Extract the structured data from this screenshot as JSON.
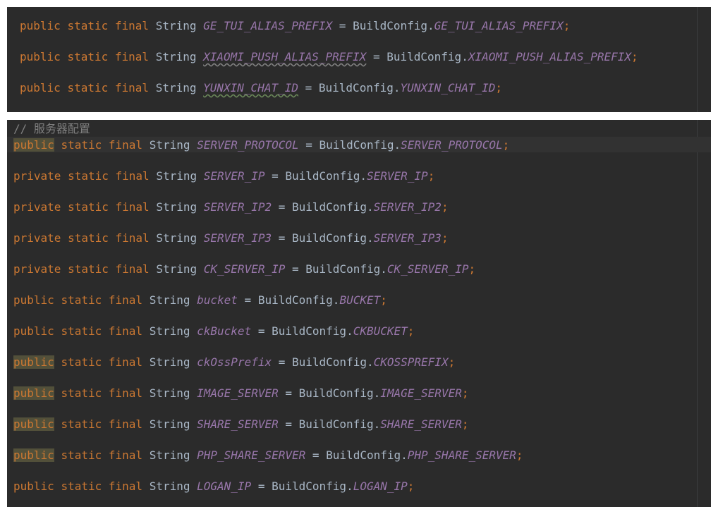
{
  "panel1": {
    "lines": [
      {
        "mod": "public",
        "static": "static",
        "final": "final",
        "type": "String",
        "name": "GE_TUI_ALIAS_PREFIX",
        "cls": "BuildConfig",
        "field": "GE_TUI_ALIAS_PREFIX"
      },
      {
        "mod": "public",
        "static": "static",
        "final": "final",
        "type": "String",
        "name": "XIAOMI_PUSH_ALIAS_PREFIX",
        "cls": "BuildConfig",
        "field": "XIAOMI_PUSH_ALIAS_PREFIX"
      },
      {
        "mod": "public",
        "static": "static",
        "final": "final",
        "type": "String",
        "name": "YUNXIN_CHAT_ID",
        "cls": "BuildConfig",
        "field": "YUNXIN_CHAT_ID"
      }
    ]
  },
  "panel2": {
    "comment": "// 服务器配置",
    "lines": [
      {
        "mod": "public",
        "static": "static",
        "final": "final",
        "type": "String",
        "name": "SERVER_PROTOCOL",
        "cls": "BuildConfig",
        "field": "SERVER_PROTOCOL"
      },
      {
        "mod": "private",
        "static": "static",
        "final": "final",
        "type": "String",
        "name": "SERVER_IP",
        "cls": "BuildConfig",
        "field": "SERVER_IP"
      },
      {
        "mod": "private",
        "static": "static",
        "final": "final",
        "type": "String",
        "name": "SERVER_IP2",
        "cls": "BuildConfig",
        "field": "SERVER_IP2"
      },
      {
        "mod": "private",
        "static": "static",
        "final": "final",
        "type": "String",
        "name": "SERVER_IP3",
        "cls": "BuildConfig",
        "field": "SERVER_IP3"
      },
      {
        "mod": "private",
        "static": "static",
        "final": "final",
        "type": "String",
        "name": "CK_SERVER_IP",
        "cls": "BuildConfig",
        "field": "CK_SERVER_IP"
      },
      {
        "mod": "public",
        "static": "static",
        "final": "final",
        "type": "String",
        "name": "bucket",
        "cls": "BuildConfig",
        "field": "BUCKET"
      },
      {
        "mod": "public",
        "static": "static",
        "final": "final",
        "type": "String",
        "name": "ckBucket",
        "cls": "BuildConfig",
        "field": "CKBUCKET"
      },
      {
        "mod": "public",
        "static": "static",
        "final": "final",
        "type": "String",
        "name": "ckOssPrefix",
        "cls": "BuildConfig",
        "field": "CKOSSPREFIX"
      },
      {
        "mod": "public",
        "static": "static",
        "final": "final",
        "type": "String",
        "name": "IMAGE_SERVER",
        "cls": "BuildConfig",
        "field": "IMAGE_SERVER"
      },
      {
        "mod": "public",
        "static": "static",
        "final": "final",
        "type": "String",
        "name": "SHARE_SERVER",
        "cls": "BuildConfig",
        "field": "SHARE_SERVER"
      },
      {
        "mod": "public",
        "static": "static",
        "final": "final",
        "type": "String",
        "name": "PHP_SHARE_SERVER",
        "cls": "BuildConfig",
        "field": "PHP_SHARE_SERVER"
      },
      {
        "mod": "public",
        "static": "static",
        "final": "final",
        "type": "String",
        "name": "LOGAN_IP",
        "cls": "BuildConfig",
        "field": "LOGAN_IP"
      }
    ]
  },
  "colors": {
    "editor_bg": "#2b2b2b",
    "keyword": "#cc7832",
    "constant": "#9876aa",
    "plain": "#a9b7c6",
    "comment": "#808080",
    "highlight": "#52503a"
  }
}
